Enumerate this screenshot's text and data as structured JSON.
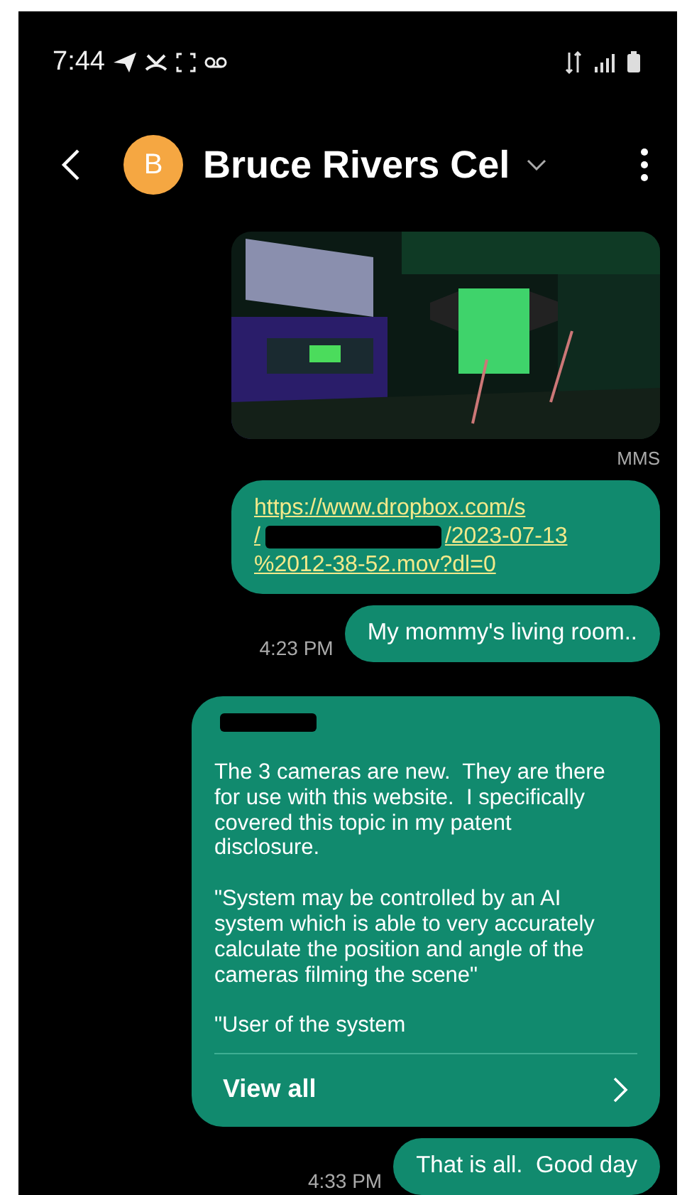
{
  "status_bar": {
    "time": "7:44"
  },
  "header": {
    "contact_initial": "B",
    "contact_name": "Bruce Rivers Cel"
  },
  "messages": [
    {
      "caption": "MMS"
    },
    {
      "kind": "link",
      "parts": [
        {
          "kind": "text",
          "text": "https://www.dropbox.com/s"
        },
        {
          "kind": "text",
          "text": "/"
        },
        {
          "kind": "redaction"
        },
        {
          "kind": "text",
          "text": "/2023-07-13"
        },
        {
          "kind": "text",
          "text": "%2012-38-52.mov?dl=0"
        }
      ]
    },
    {
      "kind": "text",
      "text": "My mommy's living room..",
      "time": "4:23 PM"
    },
    {
      "kind": "long",
      "paragraphs": [
        "The 3 cameras are new.  They are there for use with this website.  I specifically covered this topic in my patent disclosure.",
        "\"System may be controlled by an AI system which is able to very accurately calculate the position and angle of the cameras filming the scene\"",
        "\"User of the system"
      ],
      "action": "View all"
    },
    {
      "kind": "text",
      "text": "That is all.  Good day",
      "time": "4:33 PM"
    }
  ]
}
